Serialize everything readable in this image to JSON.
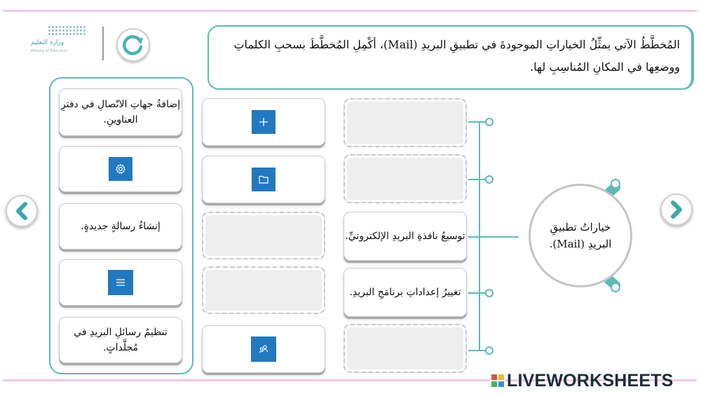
{
  "header": {
    "logo_ar": "وزارة التعليم",
    "logo_en": "Ministry of Education",
    "question": "المُخطَّطُ الآتي يمثِّلُ الخياراتِ الموجودةَ في تطبيقِ البريدِ (Mail)، أكْمِلِ المُخطَّطَ بسحبِ الكلماتِ ووضعِها في المكانِ المُناسِبِ لها."
  },
  "word_bank": [
    {
      "label": "إضافةُ جهاتِ الاتّصالِ في دفترِ العناوينِ."
    },
    {
      "icon": "gear-icon"
    },
    {
      "label": "إنشاءُ رسالةٍ جديدةٍ."
    },
    {
      "icon": "menu-icon"
    },
    {
      "label": "تنظيمُ رسائلِ البريدِ في مُجلَّداتٍ."
    }
  ],
  "icon_column": [
    {
      "icon": "plus-icon"
    },
    {
      "icon": "folder-icon"
    },
    {
      "empty": true
    },
    {
      "empty": true
    },
    {
      "icon": "people-icon"
    }
  ],
  "text_column": [
    {
      "empty": true
    },
    {
      "empty": true
    },
    {
      "label": "توسيعُ نافذةِ البريدِ الإلكترونيِّ."
    },
    {
      "label": "تغييرُ إعداداتِ برنامَجِ البريدِ."
    },
    {
      "empty": true
    }
  ],
  "center": {
    "label": "خياراتُ تطبيقِ البريدِ (Mail)."
  },
  "brand": {
    "text": "LIVEWORKSHEETS"
  },
  "colors": {
    "teal": "#5eb9b7",
    "blue": "#2279c0",
    "pink_border": "#f1c8ef"
  }
}
